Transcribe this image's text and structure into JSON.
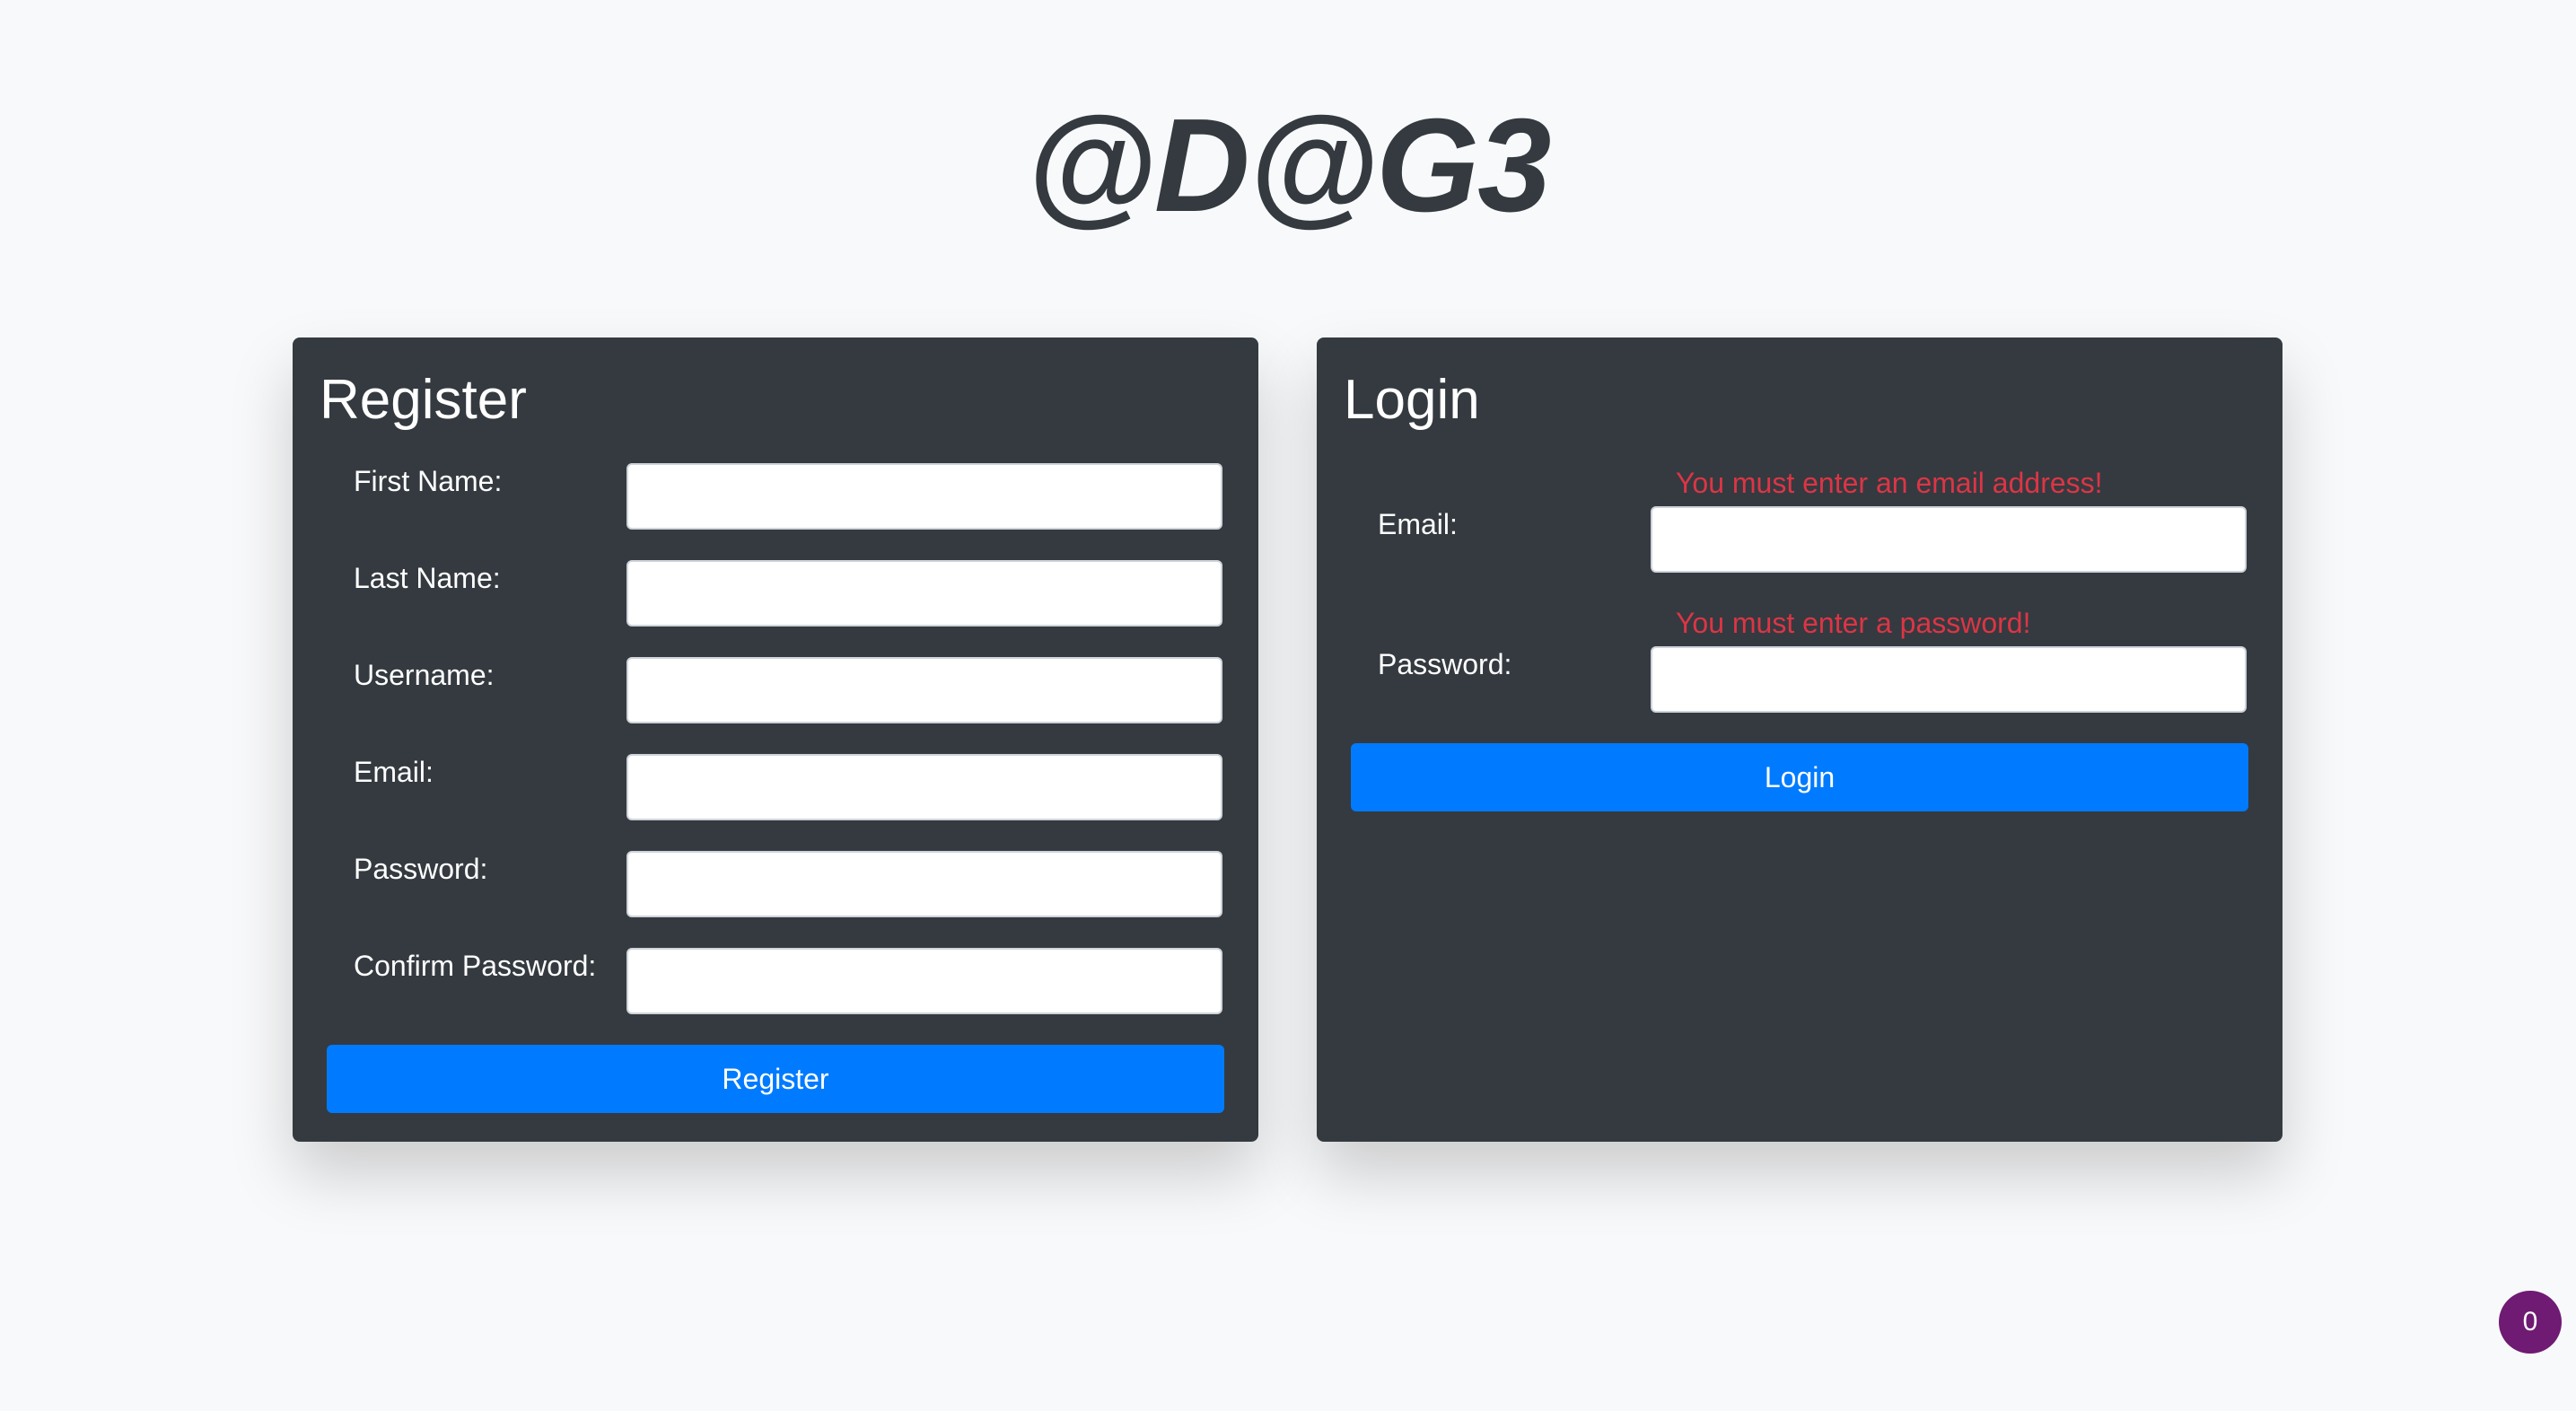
{
  "header": {
    "title": "@D@G3"
  },
  "register": {
    "title": "Register",
    "fields": [
      {
        "label": "First Name:",
        "value": ""
      },
      {
        "label": "Last Name:",
        "value": ""
      },
      {
        "label": "Username:",
        "value": ""
      },
      {
        "label": "Email:",
        "value": ""
      },
      {
        "label": "Password:",
        "value": ""
      },
      {
        "label": "Confirm Password:",
        "value": ""
      }
    ],
    "submit_label": "Register"
  },
  "login": {
    "title": "Login",
    "fields": [
      {
        "label": "Email:",
        "value": "",
        "error": "You must enter an email address!"
      },
      {
        "label": "Password:",
        "value": "",
        "error": "You must enter a password!"
      }
    ],
    "submit_label": "Login"
  },
  "badge": {
    "count": "0"
  },
  "colors": {
    "page_background": "#f8f9fa",
    "panel_background": "#343a40",
    "primary_button": "#007bff",
    "error_text": "#dc3545",
    "badge_background": "#6f1a73"
  }
}
